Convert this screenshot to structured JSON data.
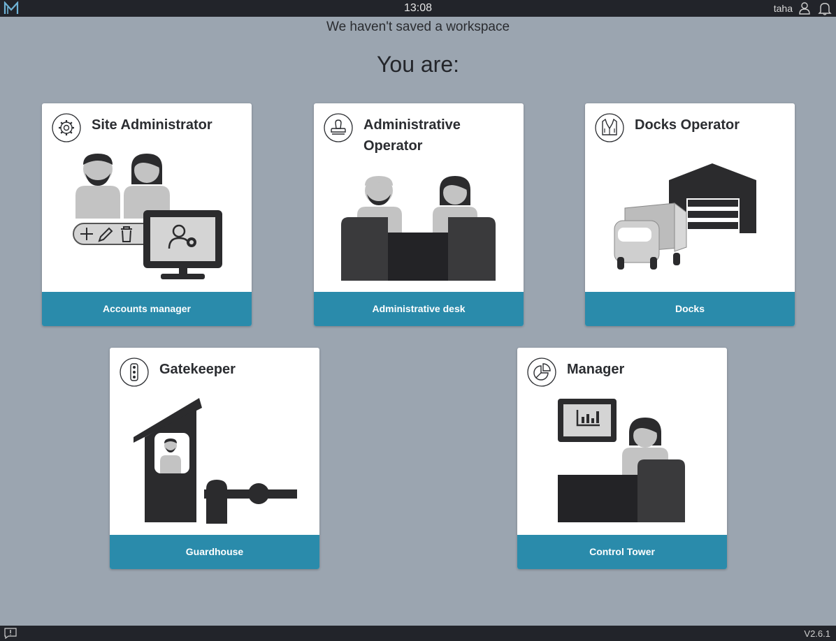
{
  "topbar": {
    "clock": "13:08",
    "user": "taha",
    "icons": [
      "app-logo",
      "user-icon",
      "bell-icon"
    ]
  },
  "banner": "We haven't saved a workspace",
  "heading": "You are:",
  "roles": [
    {
      "title": "Site Administrator",
      "footer": "Accounts manager",
      "icon": "gear-icon"
    },
    {
      "title": "Administrative Operator",
      "footer": "Administrative desk",
      "icon": "stamp-icon"
    },
    {
      "title": "Docks Operator",
      "footer": "Docks",
      "icon": "vest-icon"
    },
    {
      "title": "Gatekeeper",
      "footer": "Guardhouse",
      "icon": "traffic-light-icon"
    },
    {
      "title": "Manager",
      "footer": "Control Tower",
      "icon": "pie-chart-icon"
    }
  ],
  "bottombar": {
    "version": "V2.6.1"
  },
  "colors": {
    "background": "#9ba5b0",
    "bar": "#22242a",
    "accent": "#2a8bab"
  }
}
